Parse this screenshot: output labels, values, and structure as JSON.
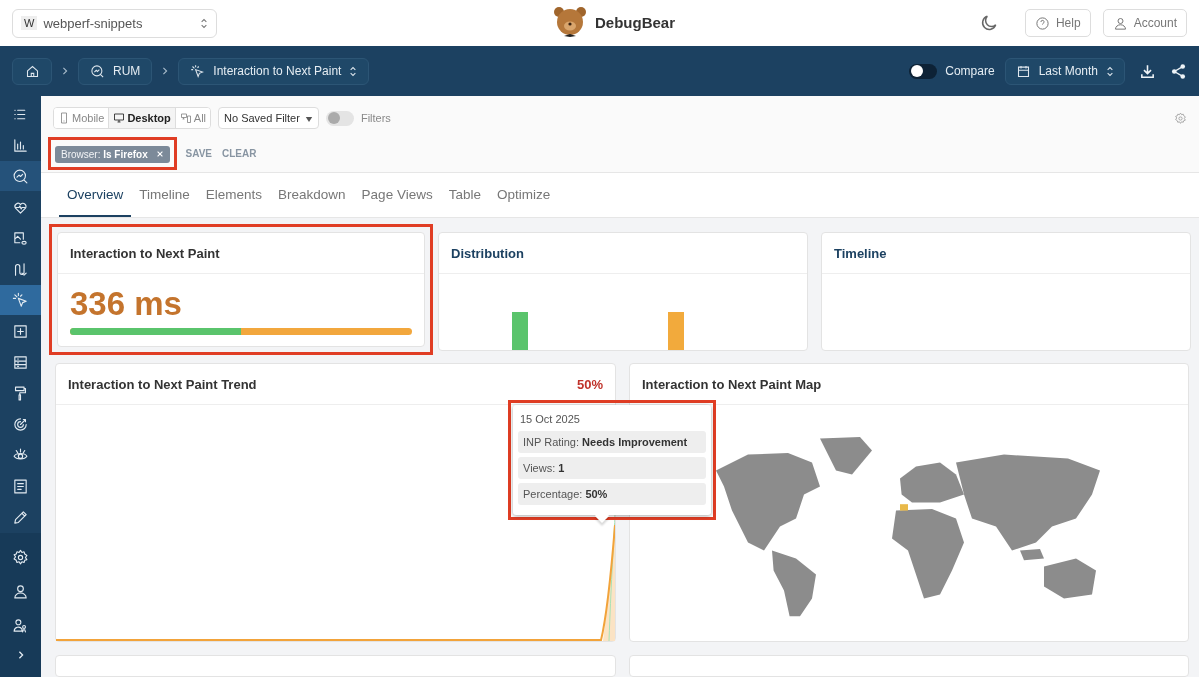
{
  "workspace": {
    "initial": "W",
    "name": "webperf-snippets"
  },
  "brand": "DebugBear",
  "header_buttons": [
    {
      "label": "Help",
      "kind": "help"
    },
    {
      "label": "Account",
      "kind": "account"
    }
  ],
  "breadcrumb": [
    {
      "label": "RUM",
      "kind": "rum"
    },
    {
      "label": "Interaction to Next Paint",
      "kind": "metric"
    }
  ],
  "compare": {
    "label": "Compare",
    "on": false
  },
  "date_range": "Last Month",
  "sidebar": {
    "items": [
      {
        "kind": "list",
        "selected": false,
        "open": false
      },
      {
        "kind": "chart",
        "selected": false,
        "open": false
      },
      {
        "kind": "rum",
        "selected": false,
        "open": true
      },
      {
        "kind": "heart",
        "selected": false,
        "open": false
      },
      {
        "kind": "image",
        "selected": false,
        "open": false
      },
      {
        "kind": "flow",
        "selected": false,
        "open": false
      },
      {
        "kind": "click",
        "selected": true,
        "open": false
      },
      {
        "kind": "plus",
        "selected": false,
        "open": false
      },
      {
        "kind": "table",
        "selected": false,
        "open": false
      },
      {
        "kind": "roller",
        "selected": false,
        "open": false
      },
      {
        "kind": "target",
        "selected": false,
        "open": false
      },
      {
        "kind": "bug",
        "selected": false,
        "open": false
      },
      {
        "kind": "doc",
        "selected": false,
        "open": false
      },
      {
        "kind": "pencil",
        "selected": false,
        "open": false
      }
    ],
    "bottom_items": [
      {
        "kind": "gear",
        "selected": false
      },
      {
        "kind": "user",
        "selected": false
      },
      {
        "kind": "users",
        "selected": false
      }
    ]
  },
  "devices": [
    {
      "label": "Mobile",
      "kind": "mobile",
      "selected": false
    },
    {
      "label": "Desktop",
      "kind": "desktop",
      "selected": true
    },
    {
      "label": "All",
      "kind": "all",
      "selected": false
    }
  ],
  "saved_filter": "No Saved Filter",
  "filters_toggle": {
    "label": "Filters",
    "on": false
  },
  "chips": [
    {
      "label": "Browser:",
      "value": "Is Firefox",
      "highlighted": true
    }
  ],
  "filter_actions": [
    "SAVE",
    "CLEAR"
  ],
  "tabs": [
    {
      "label": "Overview",
      "selected": true
    },
    {
      "label": "Timeline",
      "selected": false
    },
    {
      "label": "Elements",
      "selected": false
    },
    {
      "label": "Breakdown",
      "selected": false
    },
    {
      "label": "Page Views",
      "selected": false
    },
    {
      "label": "Table",
      "selected": false
    },
    {
      "label": "Optimize",
      "selected": false
    }
  ],
  "metric_card": {
    "title": "Interaction to Next Paint",
    "value": "336 ms",
    "level": 0.5,
    "highlighted": true
  },
  "distribution_card": {
    "title": "Distribution"
  },
  "timeline_card": {
    "title": "Timeline"
  },
  "trend_card": {
    "title": "Interaction to Next Paint Trend",
    "change": "50%",
    "tooltip": {
      "date": "15 Oct 2025",
      "highlighted": true,
      "rows": [
        {
          "label": "INP Rating:",
          "value": "Needs Improvement"
        },
        {
          "label": "Views:",
          "value": "1"
        },
        {
          "label": "Percentage:",
          "value": "50%"
        }
      ]
    }
  },
  "map_card": {
    "title": "Interaction to Next Paint Map"
  }
}
